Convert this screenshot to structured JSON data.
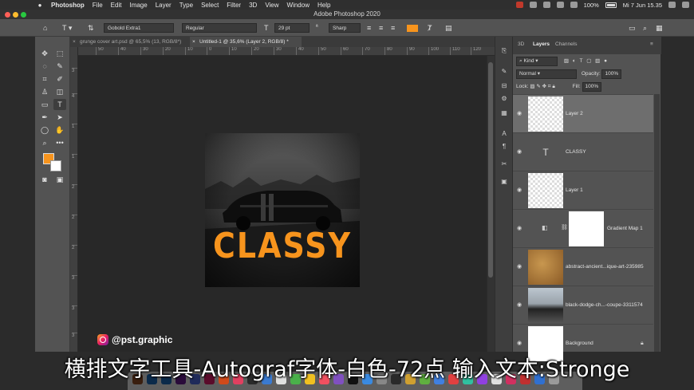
{
  "menubar": {
    "app_name": "Photoshop",
    "menus": [
      "File",
      "Edit",
      "Image",
      "Layer",
      "Type",
      "Select",
      "Filter",
      "3D",
      "View",
      "Window",
      "Help"
    ],
    "battery": "100%",
    "clock": "Mi 7 Jun  15.35"
  },
  "window": {
    "title": "Adobe Photoshop 2020"
  },
  "options": {
    "font_family": "Gobold Extra1",
    "font_style": "Regular",
    "font_size": "29 pt",
    "antialias": "Sharp",
    "text_color": "#f7941d"
  },
  "tabs": [
    {
      "label": "grunge cover art.psd @ 65,5% (13, RGB/8*)"
    },
    {
      "label": "Untitled-1 @ 35,6% (Layer 2, RGB/8) *"
    }
  ],
  "ruler_top": [
    "50",
    "40",
    "30",
    "20",
    "10",
    "0",
    "10",
    "20",
    "30",
    "40",
    "50",
    "60",
    "70",
    "80",
    "90",
    "100",
    "110",
    "120"
  ],
  "ruler_left": [
    "3",
    "4",
    "1",
    "1",
    "2",
    "2",
    "2",
    "3",
    "3",
    "3"
  ],
  "canvas": {
    "text": "CLASSY",
    "text_color": "#f7941d"
  },
  "panel": {
    "tab_3d": "3D",
    "tab_layers": "Layers",
    "tab_channels": "Channels",
    "filter_kind": "Kind",
    "blend_mode": "Normal",
    "opacity_label": "Opacity:",
    "opacity_value": "100%",
    "lock_label": "Lock:",
    "fill_label": "Fill:",
    "fill_value": "100%"
  },
  "layers": [
    {
      "name": "Layer 2",
      "selected": true
    },
    {
      "name": "CLASSY"
    },
    {
      "name": "Layer 1"
    },
    {
      "name": "Gradient Map 1"
    },
    {
      "name": "abstract-ancient...ique-art-235985"
    },
    {
      "name": "black-dodge-ch...-coupe-3311574"
    },
    {
      "name": "Background"
    }
  ],
  "watermark": {
    "handle": "@pst.graphic"
  },
  "subtitle": {
    "text": "横排文字工具-Autograf字体-白色-72点 输入文本:Stronge"
  }
}
